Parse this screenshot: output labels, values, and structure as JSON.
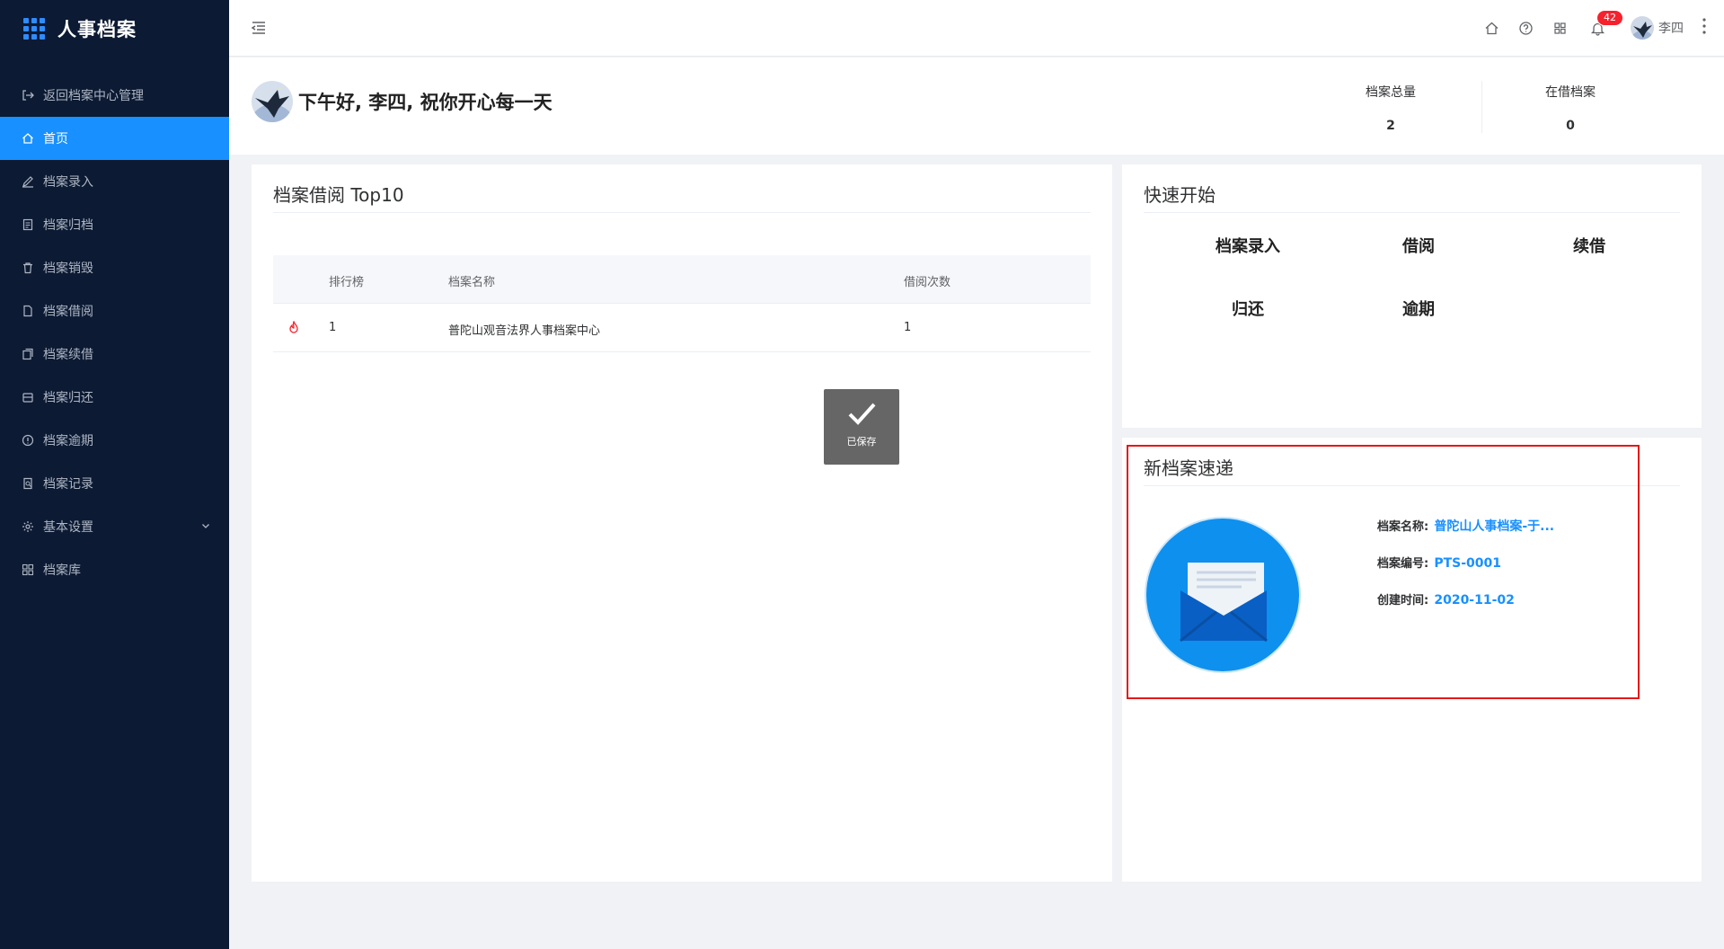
{
  "app": {
    "title": "人事档案"
  },
  "sidebar": {
    "items": [
      {
        "label": "返回档案中心管理",
        "icon": "exit-icon"
      },
      {
        "label": "首页",
        "icon": "home-icon",
        "active": true
      },
      {
        "label": "档案录入",
        "icon": "edit-icon"
      },
      {
        "label": "档案归档",
        "icon": "file-icon"
      },
      {
        "label": "档案销毁",
        "icon": "trash-icon"
      },
      {
        "label": "档案借阅",
        "icon": "document-icon"
      },
      {
        "label": "档案续借",
        "icon": "copy-icon"
      },
      {
        "label": "档案归还",
        "icon": "archive-box-icon"
      },
      {
        "label": "档案逾期",
        "icon": "alert-circle-icon"
      },
      {
        "label": "档案记录",
        "icon": "search-doc-icon"
      },
      {
        "label": "基本设置",
        "icon": "gear-icon"
      },
      {
        "label": "档案库",
        "icon": "grid-icon"
      }
    ]
  },
  "topbar": {
    "notification_count": "42",
    "user_name": "李四"
  },
  "greeting": {
    "text": "下午好, 李四, 祝你开心每一天",
    "stats": [
      {
        "label": "档案总量",
        "value": "2"
      },
      {
        "label": "在借档案",
        "value": "0"
      }
    ]
  },
  "top10": {
    "title": "档案借阅 Top10",
    "columns": [
      "排行榜",
      "档案名称",
      "借阅次数"
    ],
    "rows": [
      {
        "rank": "1",
        "name": "普陀山观音法界人事档案中心",
        "count": "1"
      }
    ]
  },
  "toast": {
    "text": "已保存"
  },
  "quickstart": {
    "title": "快速开始",
    "items": [
      "档案录入",
      "借阅",
      "续借",
      "归还",
      "逾期"
    ]
  },
  "news": {
    "title": "新档案速递",
    "name_label": "档案名称:",
    "name_value": "普陀山人事档案-于...",
    "number_label": "档案编号:",
    "number_value": "PTS-0001",
    "created_label": "创建时间:",
    "created_value": "2020-11-02"
  },
  "colors": {
    "sidebar_bg": "#0c1a33",
    "accent": "#1890ff",
    "badge": "#f5222d",
    "highlight_box": "#e31919"
  }
}
